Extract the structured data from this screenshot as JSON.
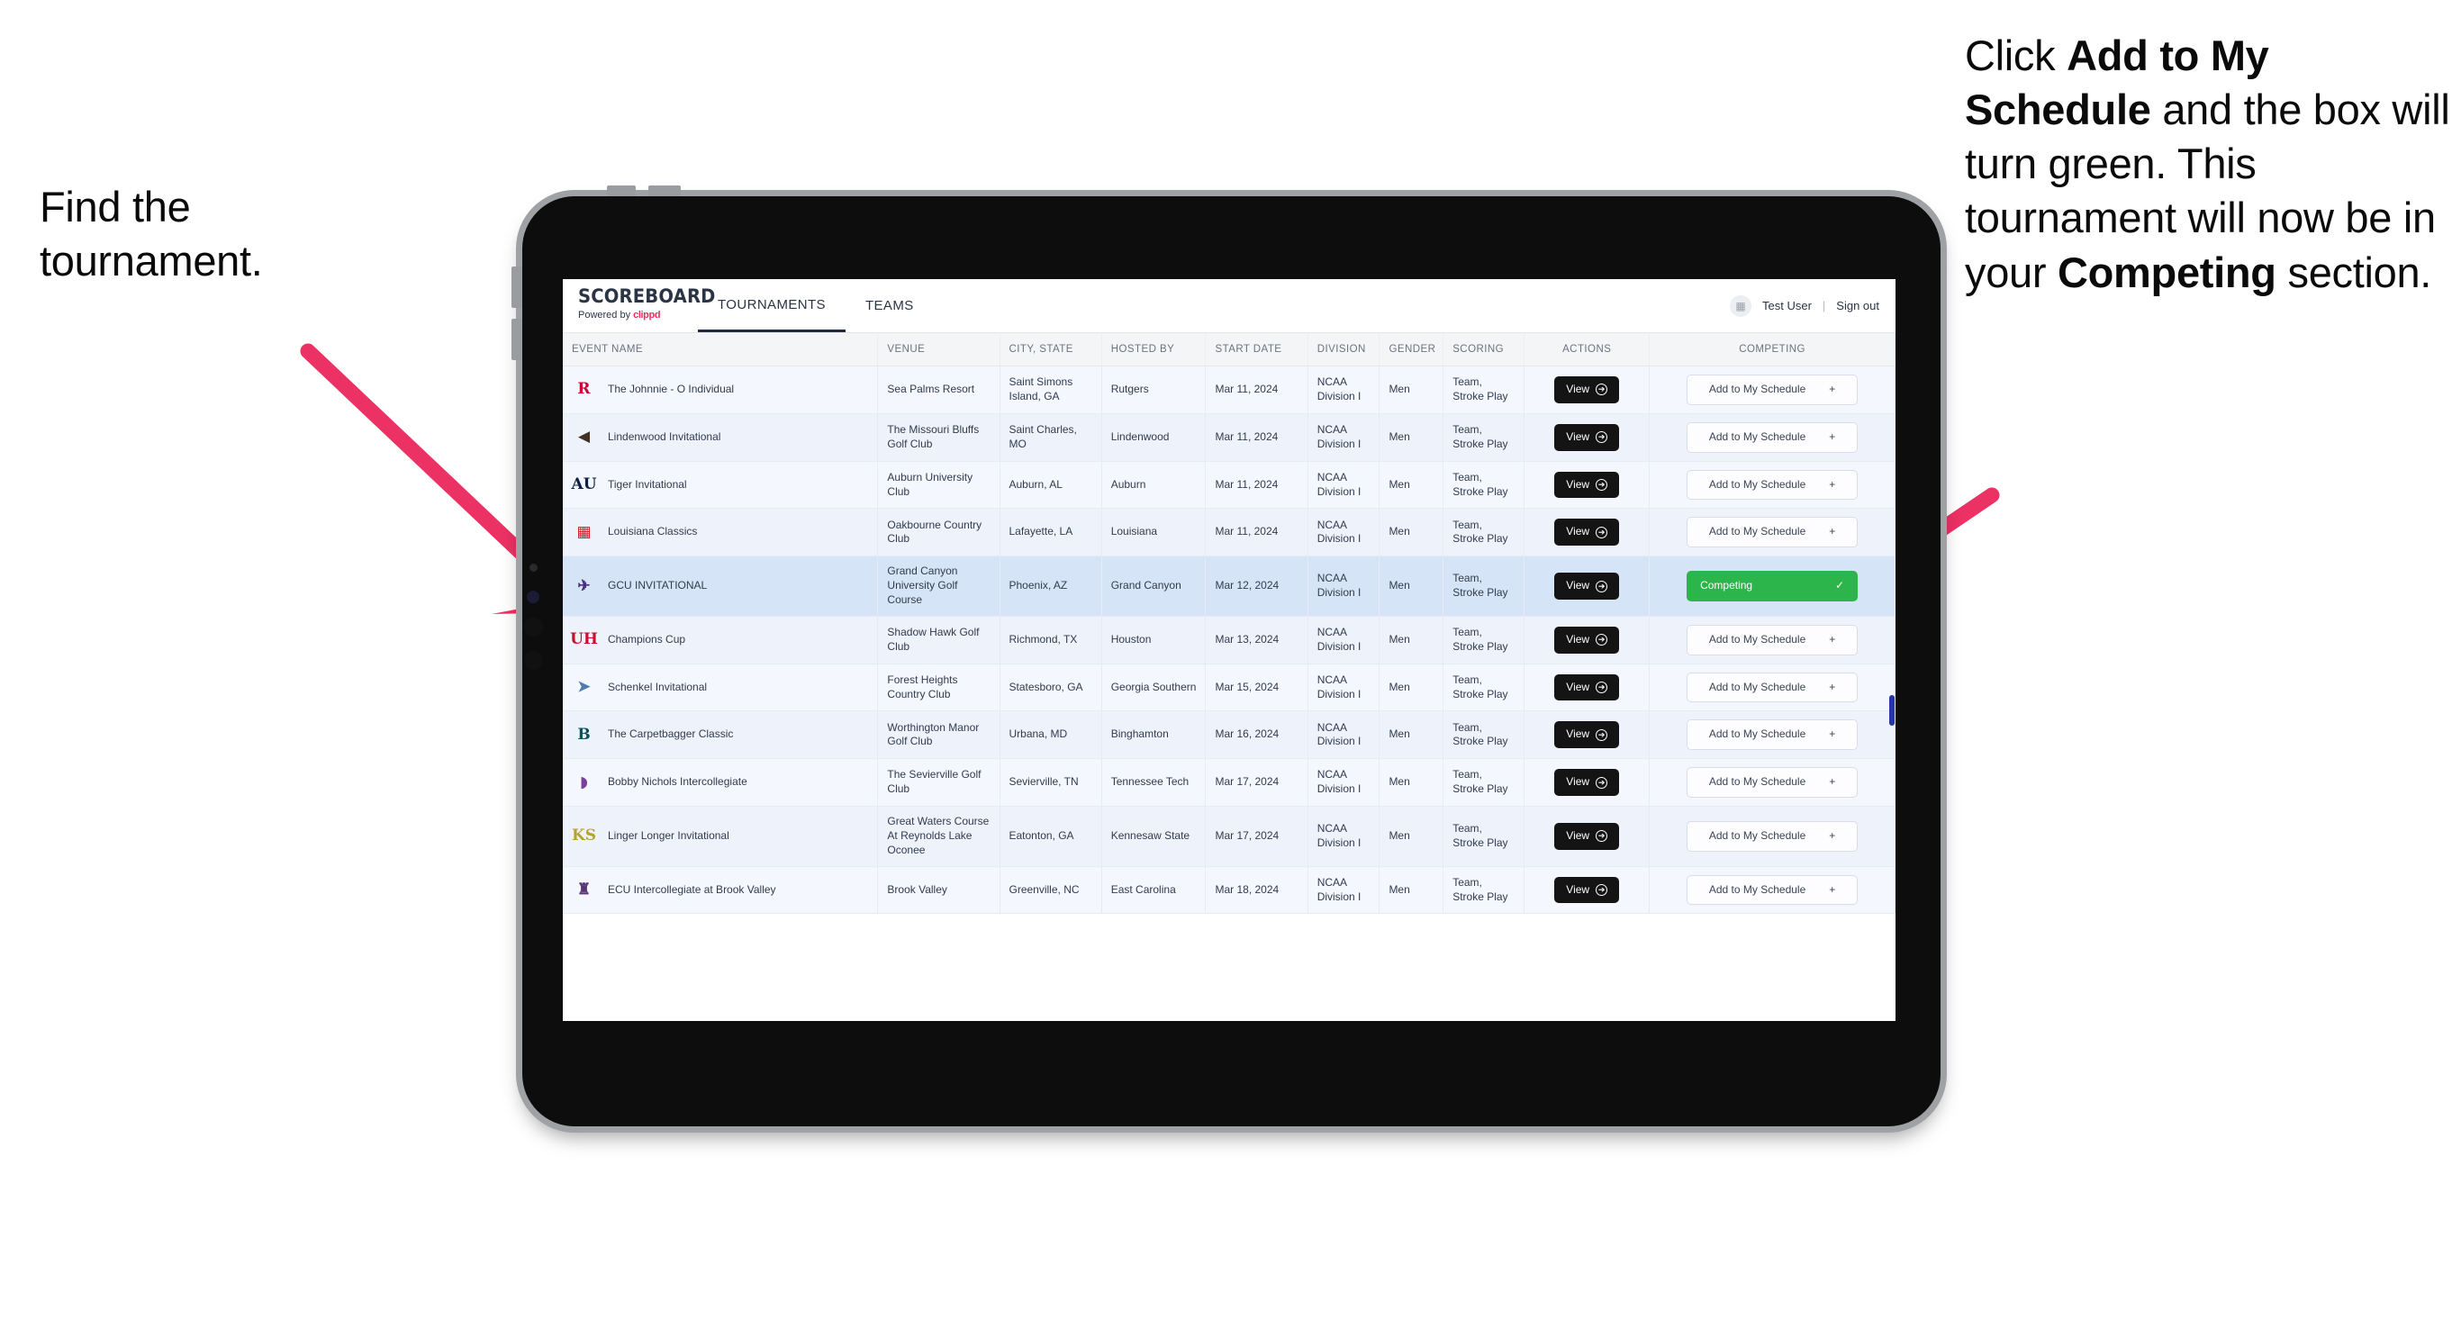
{
  "annotations": {
    "left": {
      "line1": "Find the",
      "line2": "tournament."
    },
    "right": {
      "p1_pre": "Click ",
      "p1_bold": "Add to My Schedule",
      "p1_post": " and the box will turn green. This tournament will now be in your ",
      "p1_bold2": "Competing",
      "p1_end": " section."
    }
  },
  "app": {
    "logo_word": "SCOREBOARD",
    "logo_sub_pre": "Powered by ",
    "logo_sub_brand": "clippd",
    "nav": [
      {
        "label": "TOURNAMENTS",
        "active": true
      },
      {
        "label": "TEAMS",
        "active": false
      }
    ],
    "account": {
      "avatar_icon": "user-badge-icon",
      "user": "Test User",
      "separator": "|",
      "signout": "Sign out"
    }
  },
  "table": {
    "columns": [
      "EVENT NAME",
      "VENUE",
      "CITY, STATE",
      "HOSTED BY",
      "START DATE",
      "DIVISION",
      "GENDER",
      "SCORING",
      "ACTIONS",
      "COMPETING"
    ],
    "view_label": "View",
    "add_label": "Add to My Schedule",
    "add_icon": "plus-icon",
    "competing_label": "Competing",
    "competing_icon": "check-icon",
    "competing_color": "#2bb54a",
    "rows": [
      {
        "logo": "R",
        "logo_color": "#cc0033",
        "logo_name": "rutgers-logo",
        "event": "The Johnnie - O Individual",
        "venue": "Sea Palms Resort",
        "city": "Saint Simons Island, GA",
        "host": "Rutgers",
        "date": "Mar 11, 2024",
        "division": "NCAA Division I",
        "gender": "Men",
        "scoring": "Team, Stroke Play",
        "competing": false
      },
      {
        "logo": "◀",
        "logo_color": "#3f3220",
        "logo_name": "lindenwood-lion-logo",
        "event": "Lindenwood Invitational",
        "venue": "The Missouri Bluffs Golf Club",
        "city": "Saint Charles, MO",
        "host": "Lindenwood",
        "date": "Mar 11, 2024",
        "division": "NCAA Division I",
        "gender": "Men",
        "scoring": "Team, Stroke Play",
        "competing": false
      },
      {
        "logo": "AU",
        "logo_color": "#0c2340",
        "logo_name": "auburn-logo",
        "event": "Tiger Invitational",
        "venue": "Auburn University Club",
        "city": "Auburn, AL",
        "host": "Auburn",
        "date": "Mar 11, 2024",
        "division": "NCAA Division I",
        "gender": "Men",
        "scoring": "Team, Stroke Play",
        "competing": false
      },
      {
        "logo": "▦",
        "logo_color": "#ce181e",
        "logo_name": "louisiana-ragin-cajuns-logo",
        "event": "Louisiana Classics",
        "venue": "Oakbourne Country Club",
        "city": "Lafayette, LA",
        "host": "Louisiana",
        "date": "Mar 11, 2024",
        "division": "NCAA Division I",
        "gender": "Men",
        "scoring": "Team, Stroke Play",
        "competing": false
      },
      {
        "logo": "✈",
        "logo_color": "#4b2e83",
        "logo_name": "grand-canyon-lopes-logo",
        "event": "GCU INVITATIONAL",
        "venue": "Grand Canyon University Golf Course",
        "city": "Phoenix, AZ",
        "host": "Grand Canyon",
        "date": "Mar 12, 2024",
        "division": "NCAA Division I",
        "gender": "Men",
        "scoring": "Team, Stroke Play",
        "competing": true
      },
      {
        "logo": "UH",
        "logo_color": "#c8102e",
        "logo_name": "houston-logo",
        "event": "Champions Cup",
        "venue": "Shadow Hawk Golf Club",
        "city": "Richmond, TX",
        "host": "Houston",
        "date": "Mar 13, 2024",
        "division": "NCAA Division I",
        "gender": "Men",
        "scoring": "Team, Stroke Play",
        "competing": false
      },
      {
        "logo": "➤",
        "logo_color": "#4f7ca8",
        "logo_name": "georgia-southern-eagles-logo",
        "event": "Schenkel Invitational",
        "venue": "Forest Heights Country Club",
        "city": "Statesboro, GA",
        "host": "Georgia Southern",
        "date": "Mar 15, 2024",
        "division": "NCAA Division I",
        "gender": "Men",
        "scoring": "Team, Stroke Play",
        "competing": false
      },
      {
        "logo": "B",
        "logo_color": "#0d5257",
        "logo_name": "binghamton-bearcats-logo",
        "event": "The Carpetbagger Classic",
        "venue": "Worthington Manor Golf Club",
        "city": "Urbana, MD",
        "host": "Binghamton",
        "date": "Mar 16, 2024",
        "division": "NCAA Division I",
        "gender": "Men",
        "scoring": "Team, Stroke Play",
        "competing": false
      },
      {
        "logo": "◗",
        "logo_color": "#7b3f9d",
        "logo_name": "tennessee-tech-golden-eagles-logo",
        "event": "Bobby Nichols Intercollegiate",
        "venue": "The Sevierville Golf Club",
        "city": "Sevierville, TN",
        "host": "Tennessee Tech",
        "date": "Mar 17, 2024",
        "division": "NCAA Division I",
        "gender": "Men",
        "scoring": "Team, Stroke Play",
        "competing": false
      },
      {
        "logo": "KS",
        "logo_color": "#b6a230",
        "logo_name": "kennesaw-state-owls-logo",
        "event": "Linger Longer Invitational",
        "venue": "Great Waters Course At Reynolds Lake Oconee",
        "city": "Eatonton, GA",
        "host": "Kennesaw State",
        "date": "Mar 17, 2024",
        "division": "NCAA Division I",
        "gender": "Men",
        "scoring": "Team, Stroke Play",
        "competing": false
      },
      {
        "logo": "♜",
        "logo_color": "#5a3575",
        "logo_name": "east-carolina-pirates-logo",
        "event": "ECU Intercollegiate at Brook Valley",
        "venue": "Brook Valley",
        "city": "Greenville, NC",
        "host": "East Carolina",
        "date": "Mar 18, 2024",
        "division": "NCAA Division I",
        "gender": "Men",
        "scoring": "Team, Stroke Play",
        "competing": false
      }
    ]
  }
}
